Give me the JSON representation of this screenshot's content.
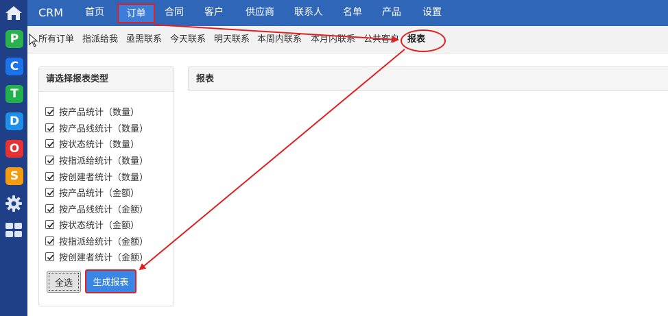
{
  "app": {
    "brand": "CRM"
  },
  "topnav": {
    "items": [
      {
        "label": "首页"
      },
      {
        "label": "订单",
        "active": true
      },
      {
        "label": "合同"
      },
      {
        "label": "客户"
      },
      {
        "label": "供应商"
      },
      {
        "label": "联系人"
      },
      {
        "label": "名单"
      },
      {
        "label": "产品"
      },
      {
        "label": "设置"
      }
    ]
  },
  "rail": {
    "apps": [
      {
        "letter": "P",
        "color": "#2bb24c",
        "icon": "p-app-icon"
      },
      {
        "letter": "C",
        "color": "#1a73e8",
        "icon": "c-app-icon"
      },
      {
        "letter": "T",
        "color": "#22b14c",
        "icon": "t-app-icon"
      },
      {
        "letter": "D",
        "color": "#1e90e8",
        "icon": "d-app-icon"
      },
      {
        "letter": "O",
        "color": "#e63232",
        "icon": "o-app-icon"
      },
      {
        "letter": "S",
        "color": "#f39c12",
        "icon": "s-app-icon"
      }
    ]
  },
  "subnav": {
    "items": [
      {
        "label": "所有订单"
      },
      {
        "label": "指派给我"
      },
      {
        "label": "亟需联系"
      },
      {
        "label": "今天联系"
      },
      {
        "label": "明天联系"
      },
      {
        "label": "本周内联系"
      },
      {
        "label": "本月内联系"
      },
      {
        "label": "公共客户"
      },
      {
        "label": "报表"
      }
    ]
  },
  "left_panel": {
    "title": "请选择报表类型",
    "options": [
      {
        "label": "按产品统计（数量）",
        "checked": true
      },
      {
        "label": "按产品线统计（数量）",
        "checked": true
      },
      {
        "label": "按状态统计（数量）",
        "checked": true
      },
      {
        "label": "按指派给统计（数量）",
        "checked": true
      },
      {
        "label": "按创建者统计（数量）",
        "checked": true
      },
      {
        "label": "按产品统计（金额）",
        "checked": true
      },
      {
        "label": "按产品线统计（金额）",
        "checked": true
      },
      {
        "label": "按状态统计（金额）",
        "checked": true
      },
      {
        "label": "按指派给统计（金额）",
        "checked": true
      },
      {
        "label": "按创建者统计（金额）",
        "checked": true
      }
    ],
    "select_all_label": "全选",
    "generate_label": "生成报表"
  },
  "right_panel": {
    "title": "报表"
  },
  "colors": {
    "accent": "#2f66b7",
    "annotation": "#e02020",
    "rail": "#1f3f86"
  }
}
